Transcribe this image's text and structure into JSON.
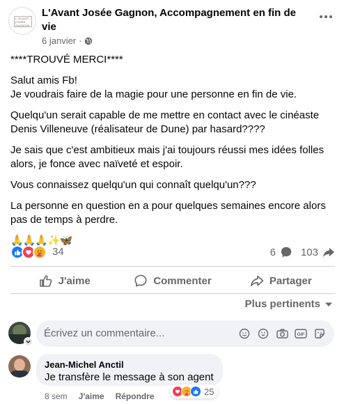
{
  "post": {
    "author": "L'Avant Josée Gagnon, Accompagnement en fin de vie",
    "logo_text": [
      "L'AVANT",
      "JOSÉE GAGNON"
    ],
    "date": "6 janvier",
    "separator": "·",
    "paragraphs": [
      "****TROUVÉ MERCI****",
      "Salut amis Fb!\nJe voudrais faire de la magie pour une personne en fin de vie.",
      "Quelqu'un serait capable de me mettre en contact avec le cinéaste Denis Villeneuve (réalisateur de Dune) par hasard????",
      "Je sais que c'est ambitieux mais j'ai toujours réussi mes idées folles alors, je fonce avec naïveté et espoir.",
      "Vous connaissez quelqu'un qui connaît quelqu'un???",
      "La personne en question en a pour quelques semaines encore alors pas de temps à perdre."
    ],
    "emoji_line": "🙏🙏🙏✨🦋"
  },
  "stats": {
    "reaction_count": "34",
    "comment_count": "6",
    "share_count": "103"
  },
  "actions": {
    "like_label": "J'aime",
    "comment_label": "Commenter",
    "share_label": "Partager"
  },
  "sort": {
    "label": "Plus pertinents"
  },
  "comment_input": {
    "placeholder": "Écrivez un commentaire..."
  },
  "comment": {
    "author": "Jean-Michel Anctil",
    "text": "Je transfère le message à son agent",
    "reaction_count": "25",
    "time": "8 sem",
    "like_label": "J'aime",
    "reply_label": "Répondre"
  },
  "colors": {
    "like_blue": "#1877f2",
    "love_red": "#f33e58",
    "care_yellow": "#f7b125",
    "secondary_text": "#65676b"
  }
}
